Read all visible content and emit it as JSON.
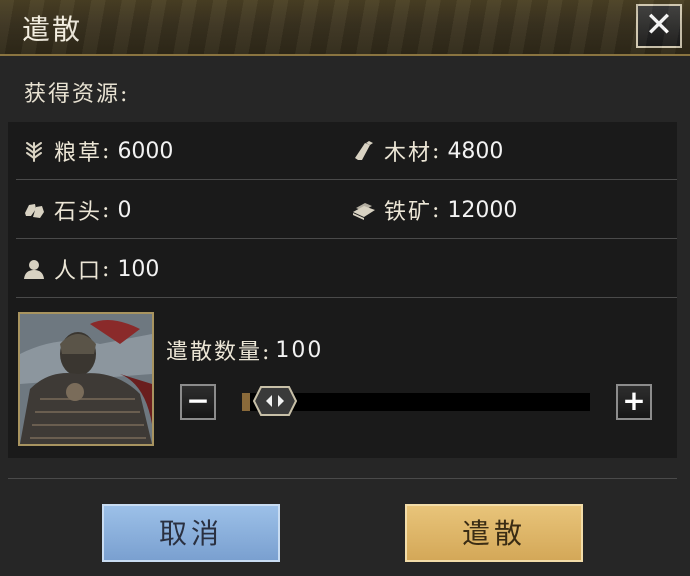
{
  "window": {
    "title": "遣散"
  },
  "section": {
    "label": "获得资源:"
  },
  "resources": [
    {
      "icon": "grain-icon",
      "label": "粮草",
      "value": "6000"
    },
    {
      "icon": "wood-icon",
      "label": "木材",
      "value": "4800"
    },
    {
      "icon": "stone-icon",
      "label": "石头",
      "value": "0"
    },
    {
      "icon": "iron-ore-icon",
      "label": "铁矿",
      "value": "12000"
    },
    {
      "icon": "population-icon",
      "label": "人口",
      "value": "100"
    }
  ],
  "dismiss": {
    "quantity_label": "遣散数量:",
    "quantity_value": "100",
    "slider_fraction": 0.02,
    "minus_label": "−",
    "plus_label": "+"
  },
  "buttons": {
    "cancel": "取消",
    "confirm": "遣散",
    "close": "✕"
  },
  "colors": {
    "cancel_button": "#8fb4e0",
    "confirm_button": "#e0b868",
    "title_bar": "#3a3220"
  }
}
